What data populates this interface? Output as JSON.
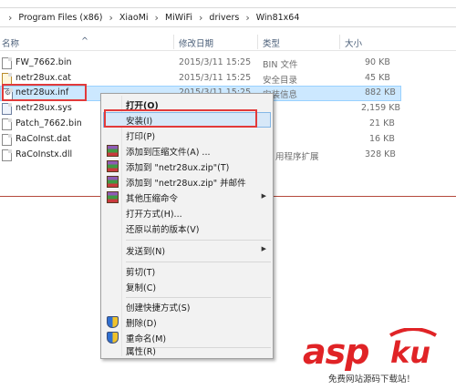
{
  "breadcrumb": {
    "items": [
      "Program Files (x86)",
      "XiaoMi",
      "MiWiFi",
      "drivers",
      "Win81x64"
    ],
    "separator": "›"
  },
  "columns": {
    "name": "名称",
    "date": "修改日期",
    "type": "类型",
    "size": "大小"
  },
  "files": [
    {
      "name": "FW_7662.bin",
      "date": "2015/3/11 15:25",
      "type": "BIN 文件",
      "size": "90 KB",
      "icon": "file-icon"
    },
    {
      "name": "netr28ux.cat",
      "date": "2015/3/11 15:25",
      "type": "安全目录",
      "size": "45 KB",
      "icon": "catalog-icon"
    },
    {
      "name": "netr28ux.inf",
      "date": "2015/3/11 15:25",
      "type": "安装信息",
      "size": "882 KB",
      "icon": "setup-info-icon"
    },
    {
      "name": "netr28ux.sys",
      "date": "",
      "type": "",
      "size": "2,159 KB",
      "icon": "system-file-icon"
    },
    {
      "name": "Patch_7662.bin",
      "date": "",
      "type": "",
      "size": "21 KB",
      "icon": "file-icon"
    },
    {
      "name": "RaCoInst.dat",
      "date": "",
      "type": "",
      "size": "16 KB",
      "icon": "file-icon"
    },
    {
      "name": "RaCoInstx.dll",
      "date": "",
      "type": "用程序扩展",
      "size": "328 KB",
      "icon": "dll-file-icon"
    }
  ],
  "context_menu": {
    "items": [
      {
        "label": "打开(O)",
        "bold": true
      },
      {
        "label": "安装(I)",
        "selected": true
      },
      {
        "label": "打印(P)"
      },
      {
        "label": "添加到压缩文件(A) ...",
        "icon": "winrar-icon"
      },
      {
        "label": "添加到 \"netr28ux.zip\"(T)",
        "icon": "winrar-icon"
      },
      {
        "label": "添加到 \"netr28ux.zip\" 并邮件",
        "icon": "winrar-icon"
      },
      {
        "label": "其他压缩命令",
        "icon": "winrar-icon",
        "submenu": true
      },
      {
        "label": "打开方式(H)..."
      },
      {
        "label": "还原以前的版本(V)"
      },
      {
        "label": "发送到(N)",
        "submenu": true
      },
      {
        "label": "剪切(T)"
      },
      {
        "label": "复制(C)"
      },
      {
        "label": "创建快捷方式(S)"
      },
      {
        "label": "删除(D)",
        "icon": "shield-icon"
      },
      {
        "label": "重命名(M)",
        "icon": "shield-icon"
      },
      {
        "label": "属性(R)"
      }
    ]
  },
  "watermark": {
    "logo_text": "asp",
    "logo_suffix": "ku",
    "subtitle": "免费网站源码下载站！"
  },
  "colors": {
    "selection": "#cce8ff",
    "highlight_box": "#e23a3a",
    "logo_red": "#e02326"
  }
}
